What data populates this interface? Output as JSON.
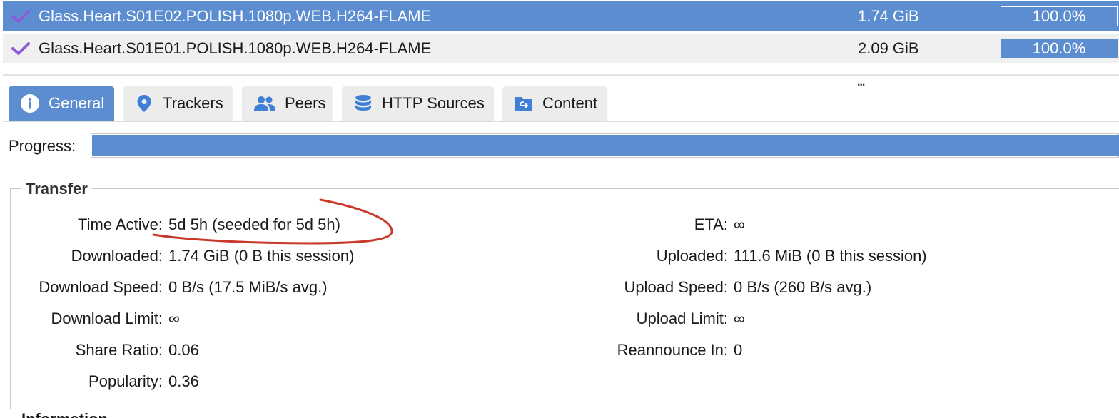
{
  "torrents": [
    {
      "name": "Glass.Heart.S01E02.POLISH.1080p.WEB.H264-FLAME",
      "size": "1.74 GiB",
      "progress_text": "100.0%",
      "progress": 1.0,
      "selected": true
    },
    {
      "name": "Glass.Heart.S01E01.POLISH.1080p.WEB.H264-FLAME",
      "size": "2.09 GiB",
      "progress_text": "100.0%",
      "progress": 1.0,
      "selected": false
    }
  ],
  "resize_handle": "...",
  "tabs": {
    "general": "General",
    "trackers": "Trackers",
    "peers": "Peers",
    "http_sources": "HTTP Sources",
    "content": "Content"
  },
  "progress": {
    "label": "Progress:",
    "value": 1.0
  },
  "transfer": {
    "legend": "Transfer",
    "time_active_label": "Time Active:",
    "time_active_value": "5d 5h (seeded for 5d 5h)",
    "downloaded_label": "Downloaded:",
    "downloaded_value": "1.74 GiB (0 B this session)",
    "download_speed_label": "Download Speed:",
    "download_speed_value": "0 B/s (17.5 MiB/s avg.)",
    "download_limit_label": "Download Limit:",
    "download_limit_value": "∞",
    "share_ratio_label": "Share Ratio:",
    "share_ratio_value": "0.06",
    "popularity_label": "Popularity:",
    "popularity_value": "0.36",
    "eta_label": "ETA:",
    "eta_value": "∞",
    "uploaded_label": "Uploaded:",
    "uploaded_value": "111.6 MiB (0 B this session)",
    "upload_speed_label": "Upload Speed:",
    "upload_speed_value": "0 B/s (260 B/s avg.)",
    "upload_limit_label": "Upload Limit:",
    "upload_limit_value": "∞",
    "reannounce_label": "Reannounce In:",
    "reannounce_value": "0"
  },
  "information_legend": "Information",
  "colors": {
    "accent": "#5b8dd0",
    "check": "#8d5bd6",
    "annotation": "#c8392b"
  },
  "icons": {
    "check": "checkmark-icon",
    "general": "info-icon",
    "trackers": "location-pin-icon",
    "peers": "users-icon",
    "http_sources": "database-icon",
    "content": "folder-icon",
    "annotation": "hand-drawn-circle-annotation"
  }
}
